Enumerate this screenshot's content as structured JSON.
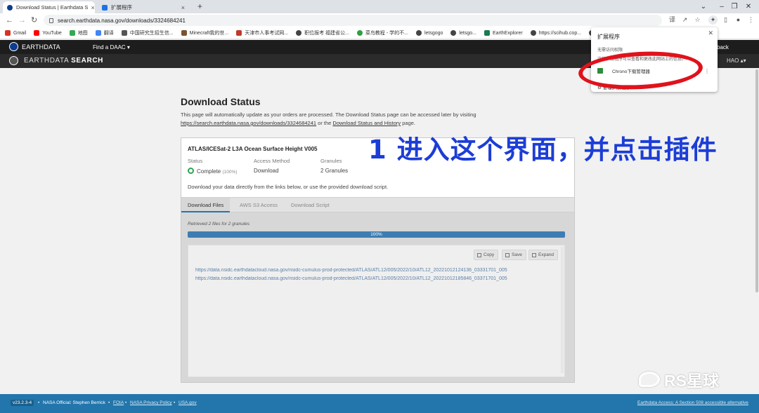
{
  "browser": {
    "tabs": [
      {
        "title": "Download Status | Earthdata S",
        "active": true
      },
      {
        "title": "扩展程序",
        "active": false
      }
    ],
    "url": "search.earthdata.nasa.gov/downloads/3324684241",
    "bookmarks": [
      "Gmail",
      "YouTube",
      "地图",
      "翻译",
      "中国研究生招生信...",
      "Minecraft我的世...",
      "天津市人事考试网...",
      "职位报考 福建省公...",
      "菜鸟教程 - 学的不...",
      "letsgogo",
      "letsgo...",
      "EarthExplorer",
      "https://scihub.cop...",
      "阿"
    ]
  },
  "colors": {
    "accent": "#2276ac",
    "success": "#2ea44f",
    "progress": "#3e7db3",
    "annotation": "#1c3dd6",
    "highlight_ring": "#e0121b"
  },
  "earthdata": {
    "brand": "EARTHDATA",
    "find_daac": "Find a DAAC",
    "feedback": "back",
    "search_brand_a": "EARTHDATA",
    "search_brand_b": "SEARCH",
    "user": "HAO"
  },
  "page": {
    "title": "Download Status",
    "intro_line1": "This page will automatically update as your orders are processed. The Download Status page can be accessed later by visiting",
    "intro_link1": "https://search.earthdata.nasa.gov/downloads/3324684241",
    "intro_mid": " or the ",
    "intro_link2": "Download Status and History",
    "intro_end": " page."
  },
  "order": {
    "dataset_title": "ATLAS/ICESat-2 L3A Ocean Surface Height V005",
    "status_label": "Status",
    "status_value": "Complete",
    "status_pct": "(100%)",
    "access_label": "Access Method",
    "access_value": "Download",
    "granules_label": "Granules",
    "granules_value": "2 Granules",
    "hint": "Download your data directly from the links below, or use the provided download script.",
    "tabs": [
      "Download Files",
      "AWS S3 Access",
      "Download Script"
    ],
    "retrieved": "Retrieved 2 files for 2 granules",
    "progress_percent": 100,
    "progress_label": "100%",
    "buttons": {
      "copy": "Copy",
      "save": "Save",
      "expand": "Expand"
    },
    "links": [
      "https://data.nsidc.earthdatacloud.nasa.gov/nsidc-cumulus-prod-protected/ATLAS/ATL12/005/2022/10/ATL12_20221012124136_03331701_005",
      "https://data.nsidc.earthdatacloud.nasa.gov/nsidc-cumulus-prod-protected/ATLAS/ATL12/005/2022/10/ATL12_20221012185846_03371701_005"
    ]
  },
  "extensions_popup": {
    "title": "扩展程序",
    "subtitle1": "无需访问权限",
    "subtitle2": "这些扩展程序可以查看和更改此网站上的信息。",
    "item": "Chrono下载管理器",
    "manage": "管理扩展程序"
  },
  "annotation": "1 进入这个界面，并点击插件",
  "footer": {
    "version": "v23.2.3-4",
    "official": "NASA Official: Stephen Berrick",
    "foia": "FOIA",
    "privacy": "NASA Privacy Policy",
    "usa": "USA.gov",
    "accessible": "Earthdata Access: A Section 508 accessible alternative"
  },
  "watermark": "RS星球"
}
